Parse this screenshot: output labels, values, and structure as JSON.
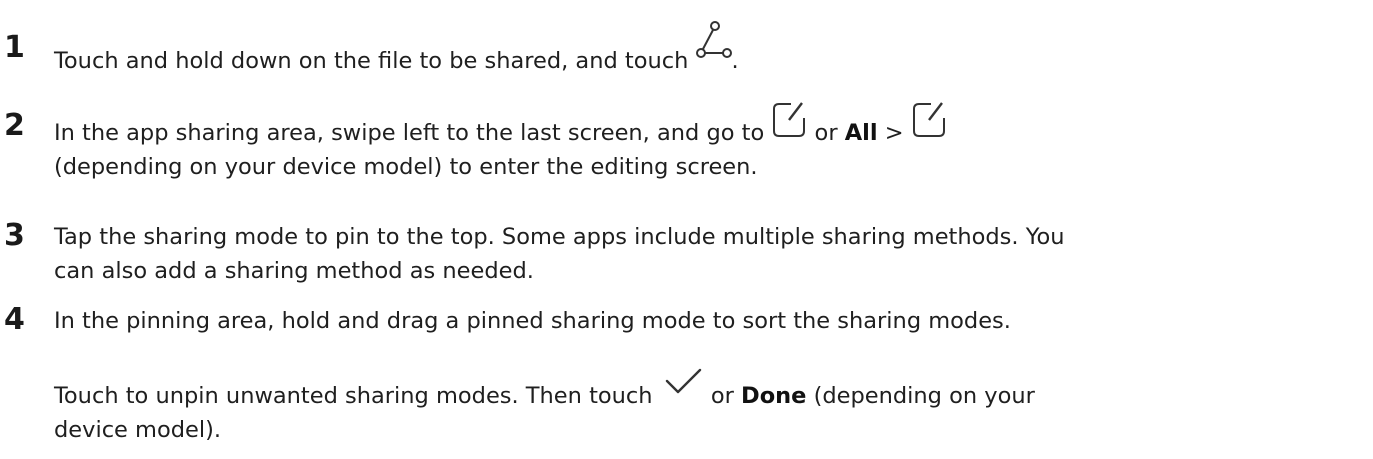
{
  "steps": [
    {
      "number": "1",
      "parts": [
        "Touch and hold down on the file to be shared, and touch ",
        "."
      ],
      "icons": [
        "share-icon"
      ]
    },
    {
      "number": "2",
      "parts": [
        "In the app sharing area, swipe left to the last screen, and go to ",
        " or ",
        "All",
        " > ",
        "(depending on your device model) to enter the editing screen."
      ],
      "icons": [
        "edit-icon",
        "edit-icon"
      ]
    },
    {
      "number": "3",
      "line1": "Tap the sharing mode to pin to the top. Some apps include multiple sharing methods. You",
      "line2": "can also add a sharing method as needed."
    },
    {
      "number": "4",
      "line1": "In the pinning area, hold and drag a pinned sharing mode to sort the sharing modes."
    }
  ],
  "note": {
    "parts": [
      "Touch to unpin unwanted sharing modes. Then touch ",
      " or ",
      "Done",
      " (depending on your",
      "device model)."
    ],
    "icons": [
      "checkmark-icon"
    ]
  }
}
